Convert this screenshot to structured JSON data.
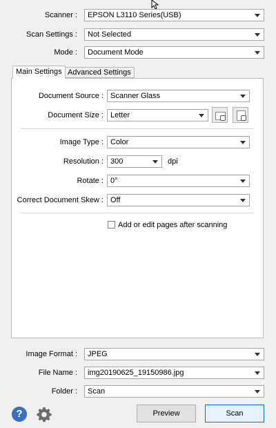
{
  "top": {
    "scanner": {
      "label": "Scanner :",
      "value": "EPSON L3110 Series(USB)"
    },
    "scan_settings": {
      "label": "Scan Settings :",
      "value": "Not Selected"
    },
    "mode": {
      "label": "Mode :",
      "value": "Document Mode"
    }
  },
  "tabs": [
    {
      "label": "Main Settings",
      "active": true
    },
    {
      "label": "Advanced Settings",
      "active": false
    }
  ],
  "main": {
    "document_source": {
      "label": "Document Source :",
      "value": "Scanner Glass"
    },
    "document_size": {
      "label": "Document Size :",
      "value": "Letter"
    },
    "image_type": {
      "label": "Image Type :",
      "value": "Color"
    },
    "resolution": {
      "label": "Resolution :",
      "value": "300",
      "unit": "dpi"
    },
    "rotate": {
      "label": "Rotate :",
      "value": "0°"
    },
    "skew": {
      "label": "Correct Document Skew :",
      "value": "Off"
    },
    "add_edit": {
      "label": "Add or edit pages after scanning",
      "checked": false
    }
  },
  "bottom": {
    "image_format": {
      "label": "Image Format :",
      "value": "JPEG"
    },
    "file_name": {
      "label": "File Name :",
      "value": "img20190625_19150986.jpg"
    },
    "folder": {
      "label": "Folder :",
      "value": "Scan"
    },
    "preview_label": "Preview",
    "scan_label": "Scan"
  },
  "icons": {
    "help": "question-icon",
    "settings": "gear-icon"
  },
  "colors": {
    "help_blue": "#3a6fc2",
    "scan_button_border": "#0078d7"
  }
}
